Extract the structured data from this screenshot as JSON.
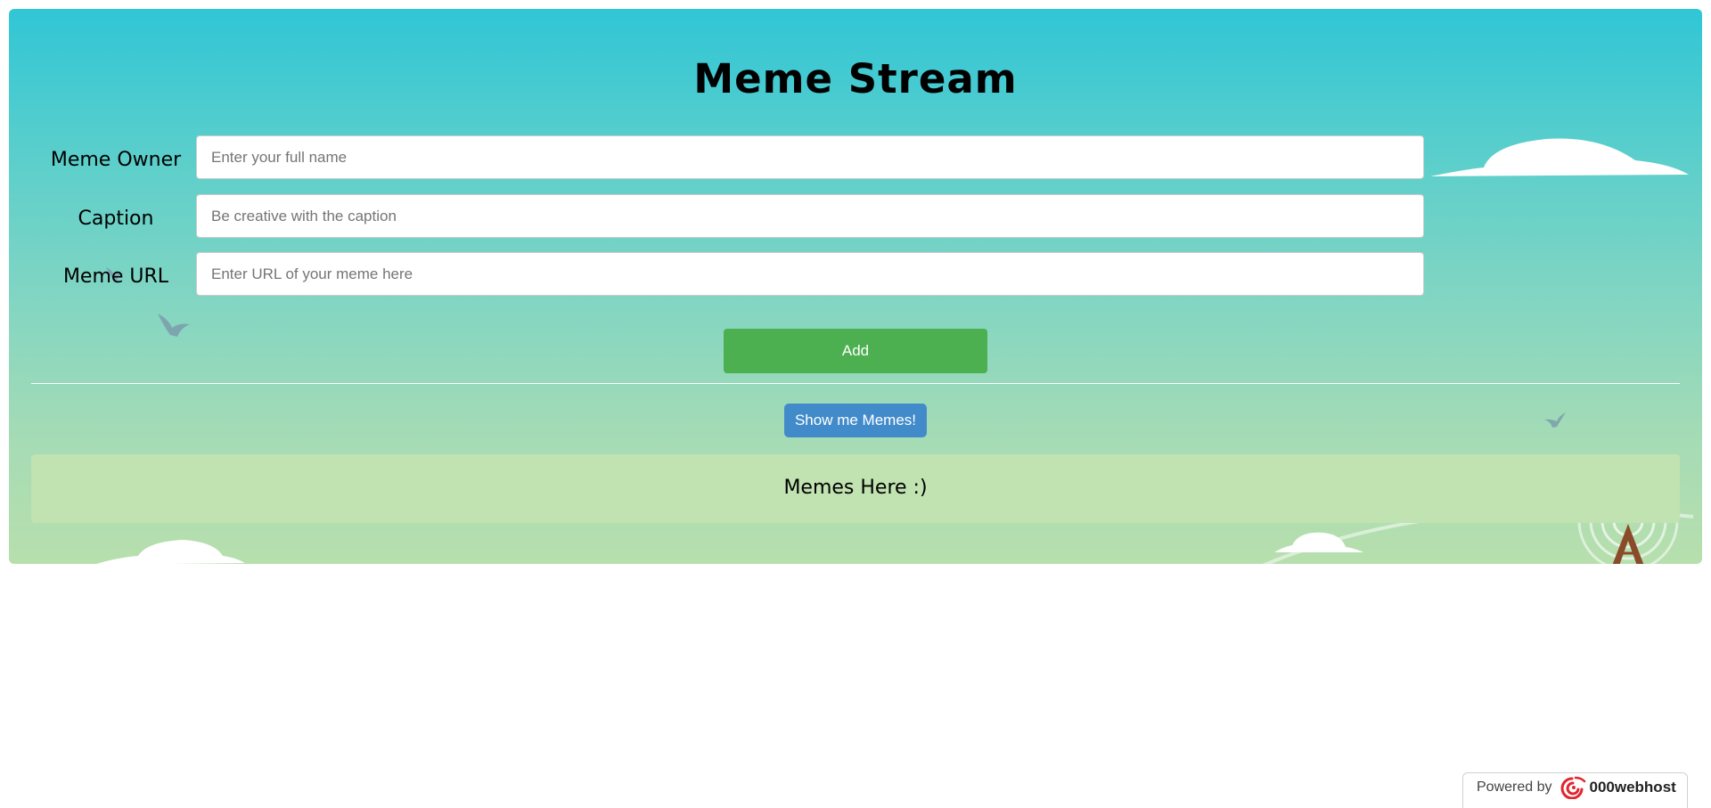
{
  "page": {
    "title": "Meme Stream"
  },
  "form": {
    "owner": {
      "label": "Meme Owner",
      "placeholder": "Enter your full name",
      "value": ""
    },
    "caption": {
      "label": "Caption",
      "placeholder": "Be creative with the caption",
      "value": ""
    },
    "url": {
      "label": "Meme URL",
      "placeholder": "Enter URL of your meme here",
      "value": ""
    },
    "add_label": "Add"
  },
  "actions": {
    "show_label": "Show me Memes!"
  },
  "memes": {
    "placeholder_text": "Memes Here :)"
  },
  "footer": {
    "powered_by": "Powered by",
    "brand": "000webhost"
  },
  "colors": {
    "add_button": "#4caf50",
    "show_button": "#428bca",
    "memes_box": "#c1e2b1",
    "gradient_top": "#30c6d6",
    "gradient_bottom": "#b7dfad",
    "brand_logo": "#e0262e"
  },
  "icons": {
    "birds": "bird-icon",
    "clouds": "cloud-icon",
    "tower": "radio-tower-icon",
    "brand_logo": "000webhost-logo-icon"
  }
}
